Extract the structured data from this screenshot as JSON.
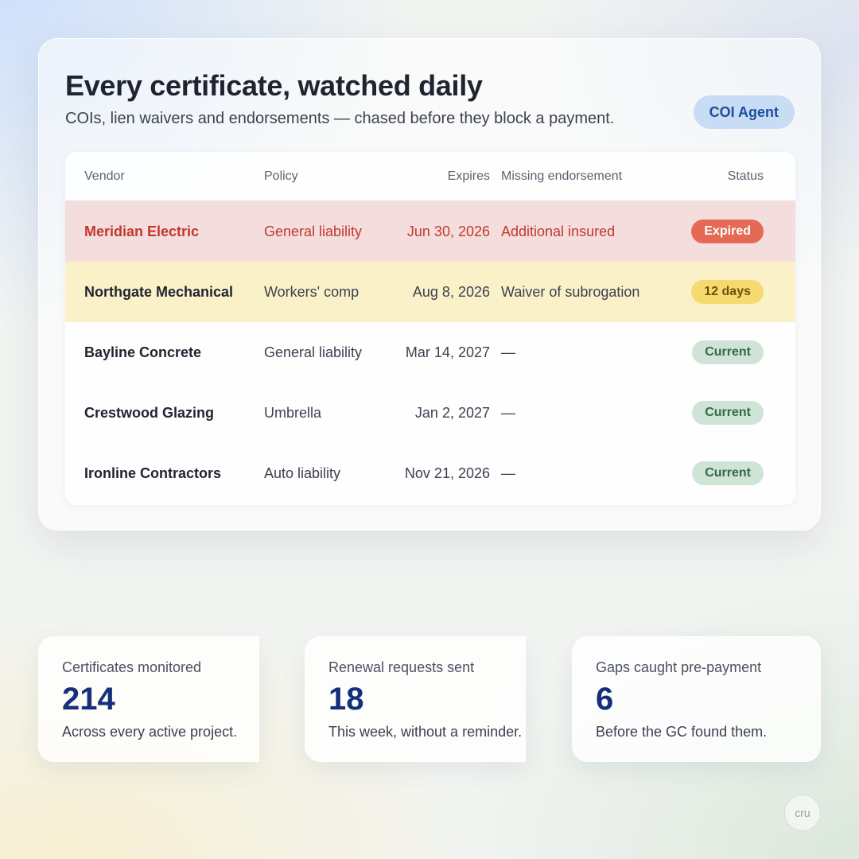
{
  "header": {
    "title": "Every certificate, watched daily",
    "subtitle": "COIs, lien waivers and endorsements — chased before they block a payment.",
    "badge": "COI Agent"
  },
  "table": {
    "columns": {
      "vendor": "Vendor",
      "policy": "Policy",
      "expires": "Expires",
      "missing": "Missing endorsement",
      "status": "Status"
    },
    "rows": [
      {
        "vendor": "Meridian Electric",
        "policy": "General liability",
        "expires": "Jun 30, 2026",
        "missing": "Additional insured",
        "status": "Expired"
      },
      {
        "vendor": "Northgate Mechanical",
        "policy": "Workers' comp",
        "expires": "Aug 8, 2026",
        "missing": "Waiver of subrogation",
        "status": "12 days"
      },
      {
        "vendor": "Bayline Concrete",
        "policy": "General liability",
        "expires": "Mar 14, 2027",
        "missing": "—",
        "status": "Current"
      },
      {
        "vendor": "Crestwood Glazing",
        "policy": "Umbrella",
        "expires": "Jan 2, 2027",
        "missing": "—",
        "status": "Current"
      },
      {
        "vendor": "Ironline Contractors",
        "policy": "Auto liability",
        "expires": "Nov 21, 2026",
        "missing": "—",
        "status": "Current"
      }
    ]
  },
  "stats": [
    {
      "label": "Certificates monitored",
      "value": "214",
      "desc": "Across every active project."
    },
    {
      "label": "Renewal requests sent",
      "value": "18",
      "desc": "This week, without a reminder."
    },
    {
      "label": "Gaps caught pre-payment",
      "value": "6",
      "desc": "Before the GC found them."
    }
  ],
  "brand": "cru",
  "colors": {
    "accent_blue": "#14307a",
    "expired_red": "#e46a55",
    "warning_yellow": "#f6da70",
    "current_green": "#cfe4d6"
  }
}
